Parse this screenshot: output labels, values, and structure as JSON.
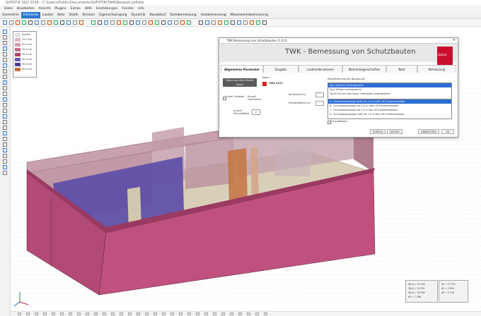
{
  "window": {
    "title": "SoFiSTiK SSD 2018 - C:\\Users\\Public\\Documents\\SoFiSTiK\\TWK\\Beispiel.sofistik"
  },
  "menu": {
    "items": [
      "Datei",
      "Bearbeiten",
      "Ansicht",
      "Plugins",
      "Extras",
      "Hilfe",
      "Einstellungen",
      "Fenster",
      "Info"
    ]
  },
  "modes": {
    "items": [
      "Geometrie",
      "Elemente",
      "Lasten",
      "Netz",
      "Statik",
      "Knicken",
      "Eigenschwingung",
      "Dynamik",
      "Bauablauf",
      "Stahlbemessung",
      "Holzbemessung",
      "Mauerwerksbemessung"
    ],
    "active_index": 1
  },
  "legend": {
    "entries": [
      {
        "label": "Schale",
        "color": "#e1e1e1"
      },
      {
        "label": "15.0 cm",
        "color": "#d9b7c3"
      },
      {
        "label": "20.0 cm",
        "color": "#cfa0a4"
      },
      {
        "label": "25.0 cm",
        "color": "#c56e87"
      },
      {
        "label": "30.0 cm",
        "color": "#b44068"
      },
      {
        "label": "40.0 cm",
        "color": "#6a56b2"
      },
      {
        "label": "50.0 cm",
        "color": "#4c3a96"
      },
      {
        "label": "60.0 cm",
        "color": "#c76b3a"
      }
    ]
  },
  "dialog": {
    "title": "TWK Bemessung von Schutzbauten (1.0.0)",
    "heading": "TWK - Bemessung von Schutzbauten",
    "logo_text": "dlubal",
    "tabs": [
      "Allgemeine Parameter",
      "Eingabe",
      "Lastkombinationen",
      "Materialeigenschaften",
      "Netz",
      "Bemessung"
    ],
    "active_tab": 0,
    "load_button": "Daten aus dem Modell laden",
    "norm_label": "Norm",
    "norm_value": "TWK 2017",
    "checkbox_label": "Unter Gelände",
    "opening_label": "Anzahl Geschosse",
    "floors_label": "Anzahl Schutzplätze",
    "floors_value": "2",
    "wall_thickness_label": "Sohldicke (m)",
    "ceiling_label": "Deckenstärke (m)",
    "classification_label": "Klassifizierung des Baugrunds",
    "list1": [
      {
        "text": "Typ I       Kohäsive Lockergesteine",
        "selected": true
      },
      {
        "text": "Typ II      Rollige Lockergesteine",
        "selected": false
      },
      {
        "text": "Typ III     Fels und sehr harte, verfestigte Lockergesteine",
        "selected": false
      }
    ],
    "list2": [
      {
        "text": "A - Grundwasserspiegel tiefer als 2.0 m unter UK Fundamentplatte",
        "selected": true
      },
      {
        "text": "B - Grundwasserspiegel bei 2.0 m unter UK Fundamentplatte",
        "selected": false
      },
      {
        "text": "C - Grundwasserspiegel bis 1.5 m über UK Fundamentplatte",
        "selected": false
      },
      {
        "text": "D - Grundwasserspiegel mehr als 1.5 m über UK Fundamentplatte",
        "selected": false
      }
    ],
    "groundwater_label": "Grundwasser",
    "btn_back": "ZURÜCK",
    "btn_next": "WEITER",
    "btn_cancel": "ABBRECHEN",
    "btn_ok": "OK"
  },
  "coords": {
    "left": [
      "X[m] = 21.504",
      "Y[m] = 21.334",
      "Z[m] = 16.363",
      "dX = 7.296"
    ],
    "right": [
      "dZ = 17.331",
      "dY = 3.054",
      "dZ = 2.134"
    ]
  },
  "colors": {
    "accent": "#2b7ad4",
    "wall_outer": "#b24a75",
    "wall_purple": "#5d4ea8",
    "wall_orange": "#c47848",
    "floor": "#d9cfb8"
  }
}
